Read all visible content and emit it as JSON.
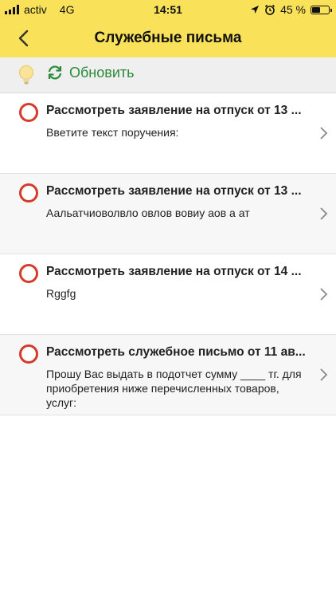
{
  "status_bar": {
    "carrier": "activ",
    "network": "4G",
    "time": "14:51",
    "battery_text": "45 %",
    "battery_level": 0.45
  },
  "nav": {
    "title": "Служебные письма"
  },
  "toolbar": {
    "refresh_label": "Обновить"
  },
  "items": [
    {
      "title": "Рассмотреть заявление на отпуск от 13 ...",
      "subtitle": "Ввeтите текст поручения:"
    },
    {
      "title": "Рассмотреть заявление на отпуск от 13 ...",
      "subtitle": "Аальатчиоволвло овлов вовиу аов а ат"
    },
    {
      "title": "Рассмотреть заявление на отпуск от 14 ...",
      "subtitle": "Rggfg"
    },
    {
      "title": "Рассмотреть служебное письмо от 11 ав...",
      "subtitle": "Прошу Вас выдать в подотчет сумму ____ тг. для приобретения ниже перечисленных товаров, услуг:"
    }
  ],
  "colors": {
    "header_bg": "#f9e15a",
    "accent_green": "#2c8a3a",
    "status_red": "#d63a2a"
  }
}
